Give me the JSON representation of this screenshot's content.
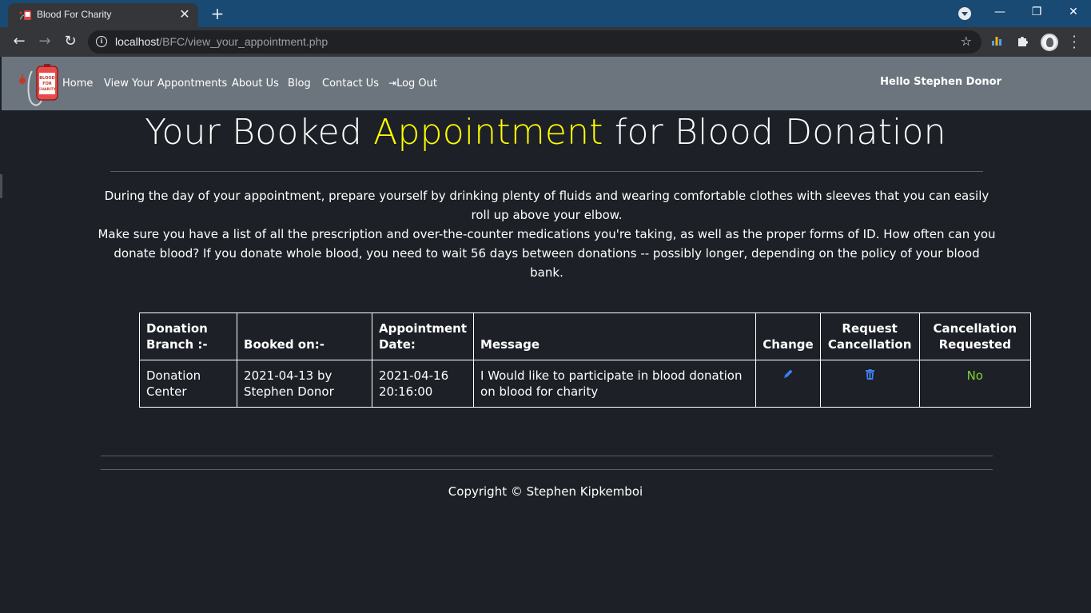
{
  "browser": {
    "tab_title": "Blood For Charity",
    "url_host": "localhost",
    "url_path": "/BFC/view_your_appointment.php"
  },
  "nav": {
    "links": [
      "Home",
      "View Your Appontments",
      "About Us",
      "Blog",
      "Contact Us",
      "Log Out"
    ],
    "greeting": "Hello Stephen Donor",
    "logo_text": [
      "BLOOD",
      "FOR",
      "CHARITY"
    ]
  },
  "main": {
    "title_before": "Your Booked ",
    "title_accent": "Appointment",
    "title_after": " for Blood Donation",
    "accent_color": "#ffff00",
    "intro_line1": "During the day of your appointment, prepare yourself by drinking plenty of fluids and wearing comfortable clothes with sleeves that you can easily roll up above your elbow.",
    "intro_line2": "Make sure you have a list of all the prescription and over-the-counter medications you're taking, as well as the proper forms of ID. How often can you donate blood? If you donate whole blood, you need to wait 56 days between donations -- possibly longer, depending on the policy of your blood bank."
  },
  "table": {
    "headers": [
      "Donation Branch :-",
      "Booked on:-",
      "Appointment Date:",
      "Message",
      "Change",
      "Request Cancellation",
      "Cancellation Requested"
    ],
    "rows": [
      {
        "branch": "Donation Center",
        "booked_on": "2021-04-13 by Stephen Donor",
        "appointment_date": "2021-04-16 20:16:00",
        "message": "I Would like to participate in blood donation on blood for charity",
        "change_icon": "pencil-icon",
        "cancel_icon": "trash-icon",
        "cancellation_requested": "No"
      }
    ]
  },
  "footer": {
    "copyright": "Copyright © Stephen Kipkemboi"
  }
}
